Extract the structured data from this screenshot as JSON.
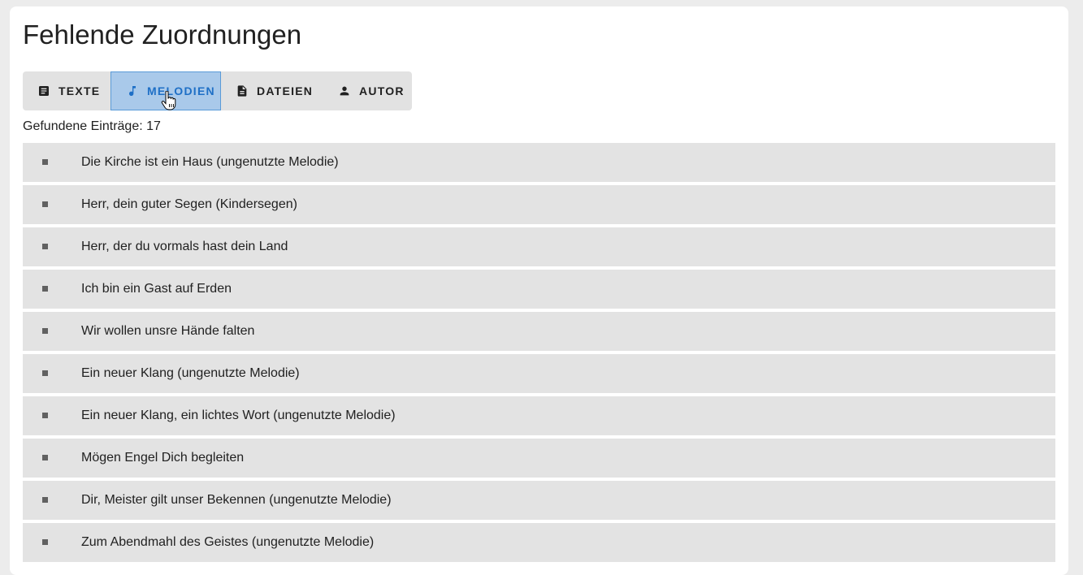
{
  "page": {
    "title": "Fehlende Zuordnungen",
    "count_label": "Gefundene Einträge:",
    "count_value": "17"
  },
  "tabs": [
    {
      "label": "TEXTE",
      "icon": "text-document-icon",
      "active": false
    },
    {
      "label": "MELODIEN",
      "icon": "music-note-icon",
      "active": true
    },
    {
      "label": "DATEIEN",
      "icon": "file-icon",
      "active": false
    },
    {
      "label": "AUTOR",
      "icon": "person-icon",
      "active": false
    }
  ],
  "items": [
    {
      "label": "Die Kirche ist ein Haus (ungenutzte Melodie)"
    },
    {
      "label": "Herr, dein guter Segen (Kindersegen)"
    },
    {
      "label": "Herr, der du vormals hast dein Land"
    },
    {
      "label": "Ich bin ein Gast auf Erden"
    },
    {
      "label": "Wir wollen unsre Hände falten"
    },
    {
      "label": "Ein neuer Klang (ungenutzte Melodie)"
    },
    {
      "label": "Ein neuer Klang, ein lichtes Wort (ungenutzte Melodie)"
    },
    {
      "label": "Mögen Engel Dich begleiten"
    },
    {
      "label": "Dir, Meister gilt unser Bekennen (ungenutzte Melodie)"
    },
    {
      "label": "Zum Abendmahl des Geistes (ungenutzte Melodie)"
    }
  ],
  "colors": {
    "background": "#ececec",
    "card": "#ffffff",
    "tabbar": "#e2e2e2",
    "active_tab_bg": "#a9c9ea",
    "active_tab_text": "#1e6fc6",
    "list_item_bg": "#e3e3e3"
  }
}
